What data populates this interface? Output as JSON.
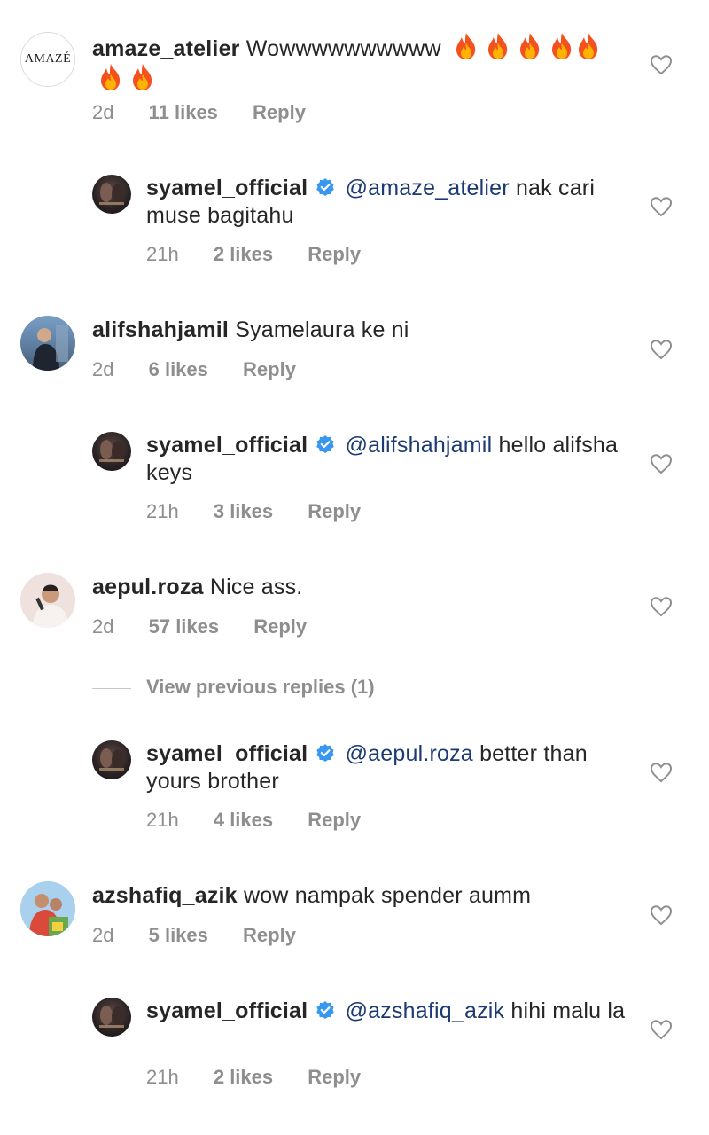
{
  "comments": [
    {
      "username": "amaze_atelier",
      "text": "Wowwwwwwwwww",
      "emoji_count": 7,
      "time": "2d",
      "likes": "11 likes",
      "reply_label": "Reply",
      "avatar_text": "AMAZÉ"
    },
    {
      "username": "syamel_official",
      "mention": "@amaze_atelier",
      "text": "nak cari muse bagitahu",
      "time": "21h",
      "likes": "2 likes",
      "reply_label": "Reply"
    },
    {
      "username": "alifshahjamil",
      "text": "Syamelaura ke ni",
      "time": "2d",
      "likes": "6 likes",
      "reply_label": "Reply"
    },
    {
      "username": "syamel_official",
      "mention": "@alifshahjamil",
      "text": "hello alifsha keys",
      "time": "21h",
      "likes": "3 likes",
      "reply_label": "Reply"
    },
    {
      "username": "aepul.roza",
      "text": "Nice ass.",
      "time": "2d",
      "likes": "57 likes",
      "reply_label": "Reply"
    },
    {
      "username": "syamel_official",
      "mention": "@aepul.roza",
      "text": "better than yours brother",
      "time": "21h",
      "likes": "4 likes",
      "reply_label": "Reply"
    },
    {
      "username": "azshafiq_azik",
      "text": "wow nampak spender aumm",
      "time": "2d",
      "likes": "5 likes",
      "reply_label": "Reply"
    },
    {
      "username": "syamel_official",
      "mention": "@azshafiq_azik",
      "text": "hihi malu la",
      "time": "21h",
      "likes": "2 likes",
      "reply_label": "Reply"
    }
  ],
  "view_previous": "View previous replies (1)",
  "colors": {
    "text": "#262626",
    "meta": "#8e8e8e",
    "mention": "#1c3a73",
    "verified": "#3897f0"
  }
}
